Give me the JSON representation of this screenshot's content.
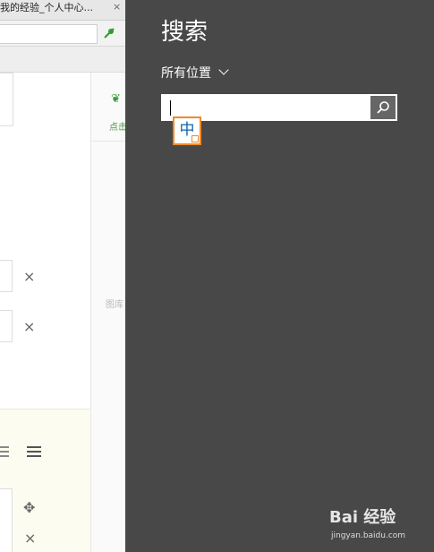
{
  "background_page": {
    "tab_title": "我的经验_个人中心...",
    "tab_close": "×",
    "side_text": "点击",
    "side_text_2": "图库",
    "remove_symbol": "×",
    "move_symbol": "✥"
  },
  "search_charm": {
    "title": "搜索",
    "scope_label": "所有位置",
    "input_value": "",
    "input_placeholder": "",
    "ime_mode": "中"
  },
  "watermark": {
    "logo": "Bai 经验",
    "url": "jingyan.baidu.com"
  },
  "colors": {
    "charm_background": "#484848",
    "search_button": "#666666",
    "ime_border": "#f08a26",
    "ime_text": "#0a64b4"
  }
}
